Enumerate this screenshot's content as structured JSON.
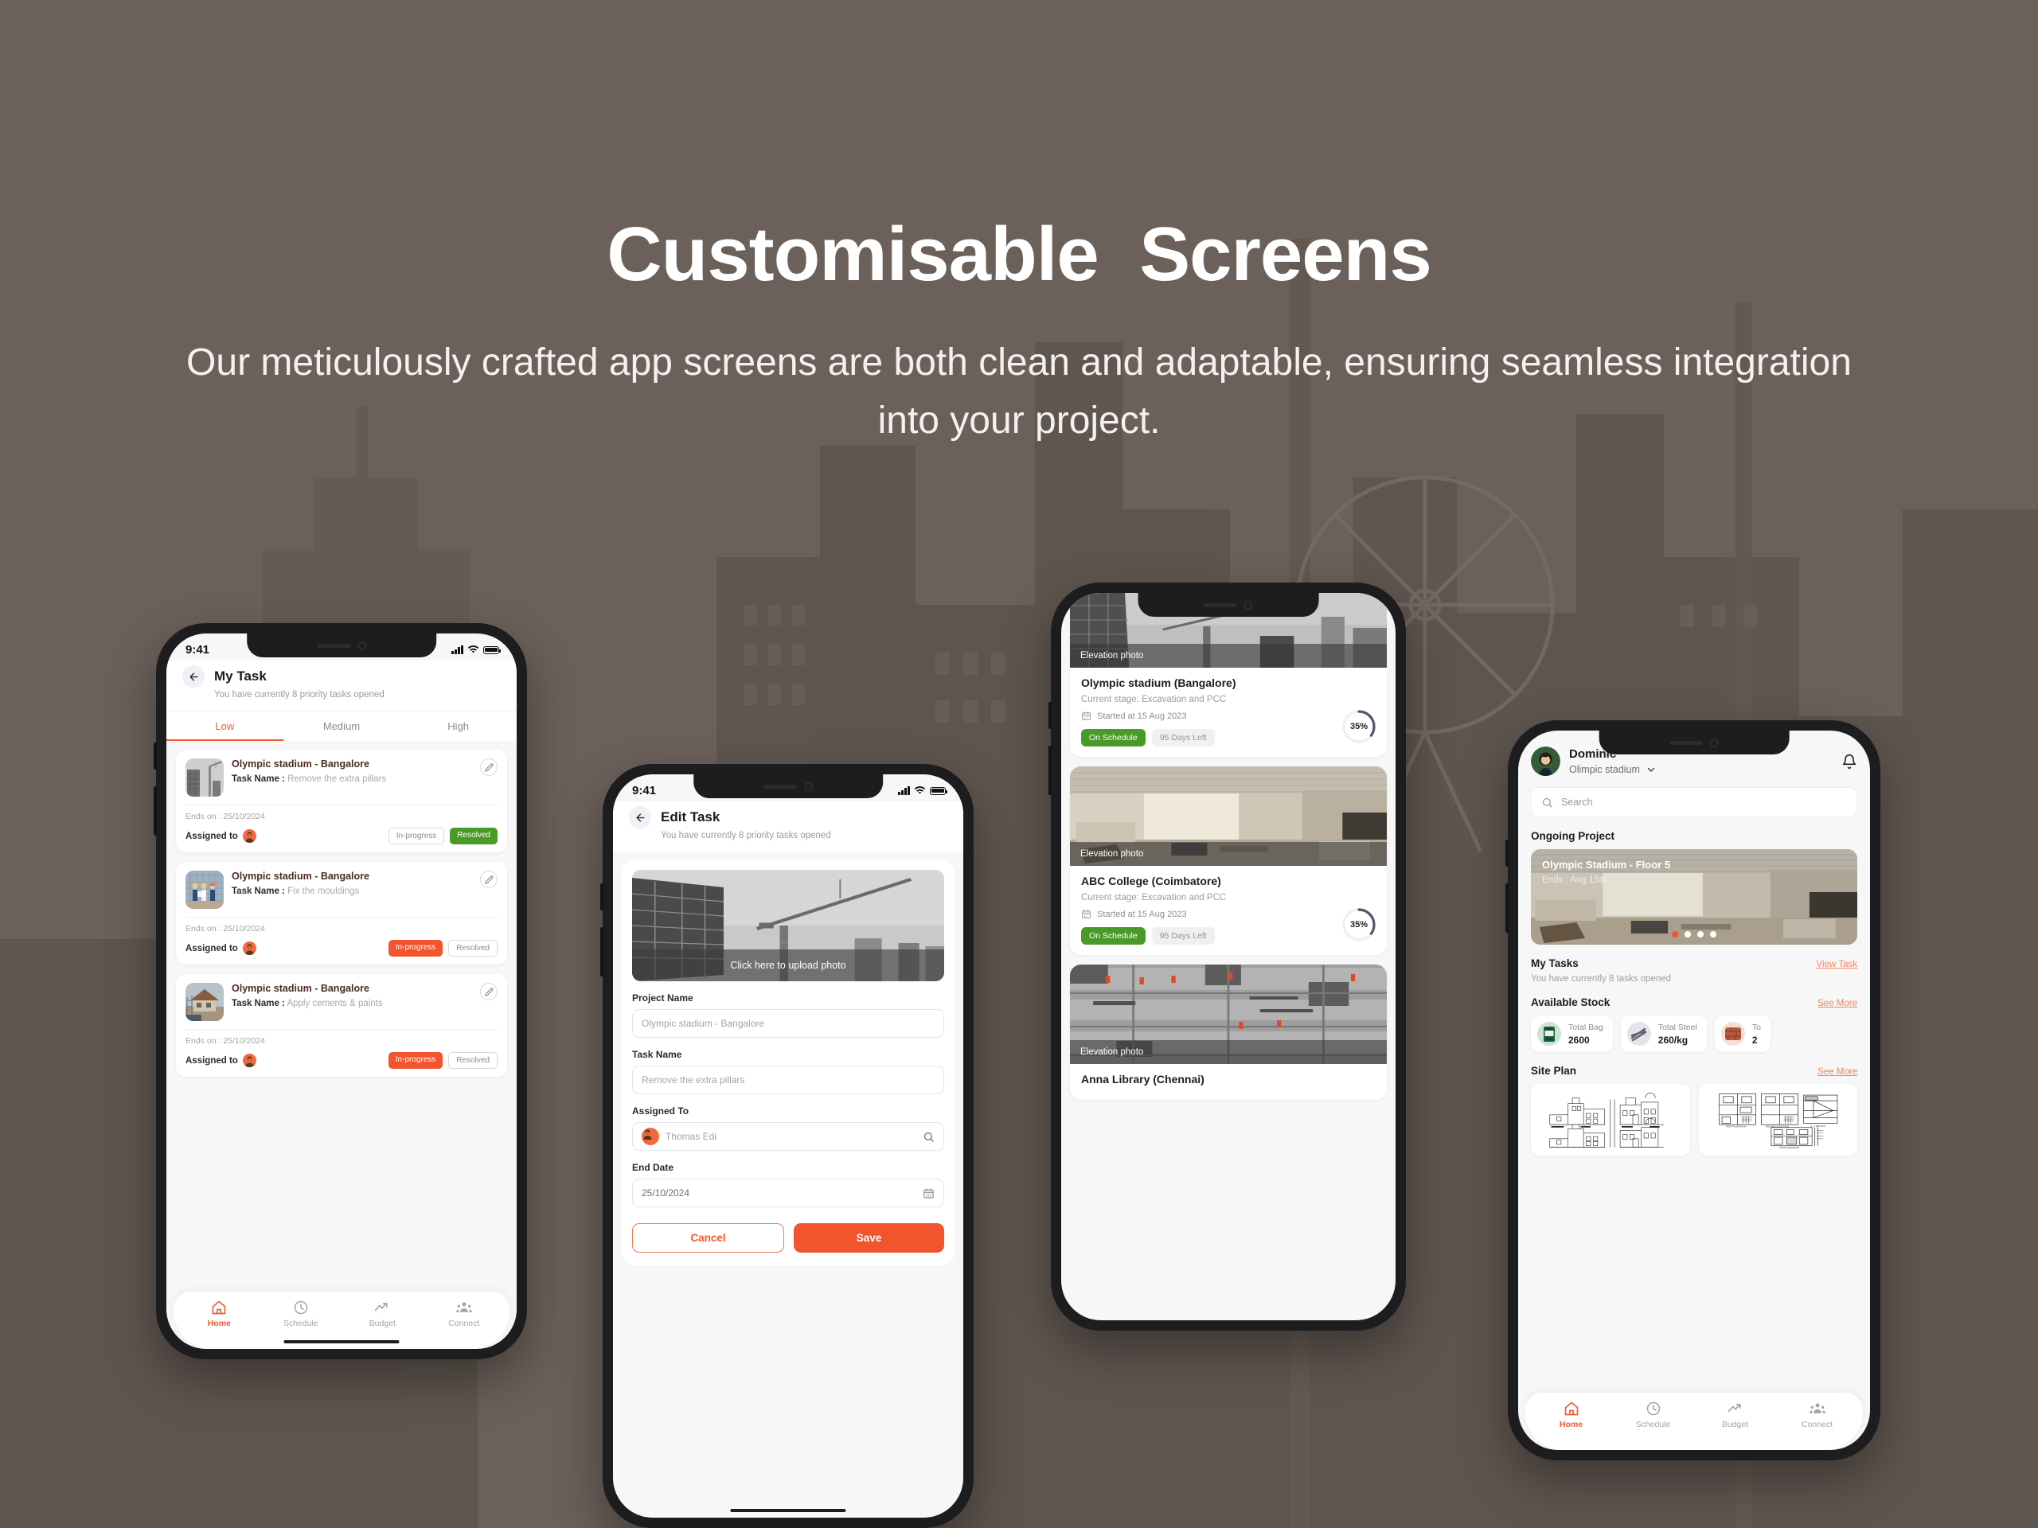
{
  "hero": {
    "title": "Customisable  Screens",
    "subtitle": "Our meticulously crafted app screens are both clean and adaptable, ensuring seamless integration into your project."
  },
  "colors": {
    "background": "#6b605a",
    "accent": "#f2542d",
    "accent_light": "#f0845f",
    "success": "#4a9a28",
    "title_text": "#ffffff"
  },
  "phone1": {
    "status": {
      "time": "9:41"
    },
    "header": {
      "title": "My Task",
      "subtitle": "You have currently 8 priority tasks opened",
      "back_icon": "arrow-left-icon"
    },
    "tabs": [
      {
        "label": "Low",
        "active": true
      },
      {
        "label": "Medium",
        "active": false
      },
      {
        "label": "High",
        "active": false
      }
    ],
    "tasks": [
      {
        "project": "Olympic stadium - Bangalore",
        "task_label": "Task Name :",
        "task_value": "Remove the extra pillars",
        "ends_on": "Ends on : 25/10/2024",
        "assigned_label": "Assigned to",
        "chip_progress": "In-progress",
        "chip_resolved": "Resolved",
        "active_chip": "resolved"
      },
      {
        "project": "Olympic stadium - Bangalore",
        "task_label": "Task Name :",
        "task_value": "Fix the mouldings",
        "ends_on": "Ends on : 25/10/2024",
        "assigned_label": "Assigned to",
        "chip_progress": "In-progress",
        "chip_resolved": "Resolved",
        "active_chip": "progress"
      },
      {
        "project": "Olympic stadium - Bangalore",
        "task_label": "Task Name :",
        "task_value": "Apply cements & paints",
        "ends_on": "Ends on : 25/10/2024",
        "assigned_label": "Assigned to",
        "chip_progress": "In-progress",
        "chip_resolved": "Resolved",
        "active_chip": "progress"
      }
    ],
    "nav": [
      {
        "label": "Home",
        "icon": "home-icon",
        "active": true
      },
      {
        "label": "Schedule",
        "icon": "clock-icon",
        "active": false
      },
      {
        "label": "Budget",
        "icon": "trending-up-icon",
        "active": false
      },
      {
        "label": "Connect",
        "icon": "people-icon",
        "active": false
      }
    ]
  },
  "phone2": {
    "status": {
      "time": "9:41"
    },
    "header": {
      "title": "Edit Task",
      "subtitle": "You have currently 8 priority tasks opened",
      "back_icon": "arrow-left-icon"
    },
    "upload": {
      "caption": "Click here to upload photo"
    },
    "fields": [
      {
        "label": "Project Name",
        "value": "Olympic stadium - Bangalore",
        "icon": ""
      },
      {
        "label": "Task Name",
        "value": "Remove the extra pillars",
        "icon": ""
      },
      {
        "label": "Assigned To",
        "value": "Thomas Edi",
        "icon": "search-icon",
        "avatar": true
      },
      {
        "label": "End Date",
        "value": "25/10/2024",
        "icon": "calendar-icon"
      }
    ],
    "actions": {
      "cancel": "Cancel",
      "save": "Save"
    }
  },
  "phone3": {
    "projects": [
      {
        "photo_caption": "Elevation photo",
        "name": "Olympic stadium (Bangalore)",
        "stage": "Current stage: Excavation and PCC",
        "started": "Started at 15 Aug 2023",
        "status_chip": "On Schedule",
        "days_chip": "95 Days Left",
        "progress": "35%",
        "progress_value": 35
      },
      {
        "photo_caption": "Elevation photo",
        "name": "ABC College (Coimbatore)",
        "stage": "Current stage: Excavation and PCC",
        "started": "Started at 15 Aug 2023",
        "status_chip": "On Schedule",
        "days_chip": "95 Days Left",
        "progress": "35%",
        "progress_value": 35
      },
      {
        "photo_caption": "Elevation photo",
        "name": "Anna Library (Chennai)",
        "stage": "",
        "started": "",
        "status_chip": "",
        "days_chip": "",
        "progress": "",
        "progress_value": 0
      }
    ]
  },
  "phone4": {
    "user": {
      "name": "Dominic",
      "project": "Olimpic stadium",
      "chevron_icon": "chevron-down-icon"
    },
    "bell_icon": "bell-icon",
    "search": {
      "placeholder": "Search",
      "icon": "search-icon"
    },
    "ongoing": {
      "section_title": "Ongoing Project",
      "card_title": "Olympic Stadium - Floor 5",
      "card_ends": "Ends : Aug 15th",
      "dots": 4,
      "active_dot": 0
    },
    "my_tasks": {
      "section_title": "My Tasks",
      "link": "View Task",
      "subtitle": "You have currently 8 tasks opened"
    },
    "stock": {
      "section_title": "Available Stock",
      "link": "See More",
      "items": [
        {
          "label": "Total Bag",
          "value": "2600",
          "icon": "cement-bag-icon"
        },
        {
          "label": "Total Steel",
          "value": "260/kg",
          "icon": "steel-rods-icon"
        },
        {
          "label": "To",
          "value": "2",
          "icon": "brick-icon"
        }
      ]
    },
    "site_plan": {
      "section_title": "Site Plan",
      "link": "See More",
      "items": [
        {
          "name": "elevation-drawing"
        },
        {
          "name": "floor-plan-drawing"
        }
      ]
    },
    "nav": [
      {
        "label": "Home",
        "icon": "home-icon",
        "active": true
      },
      {
        "label": "Schedule",
        "icon": "clock-icon",
        "active": false
      },
      {
        "label": "Budget",
        "icon": "trending-up-icon",
        "active": false
      },
      {
        "label": "Connect",
        "icon": "people-icon",
        "active": false
      }
    ]
  }
}
